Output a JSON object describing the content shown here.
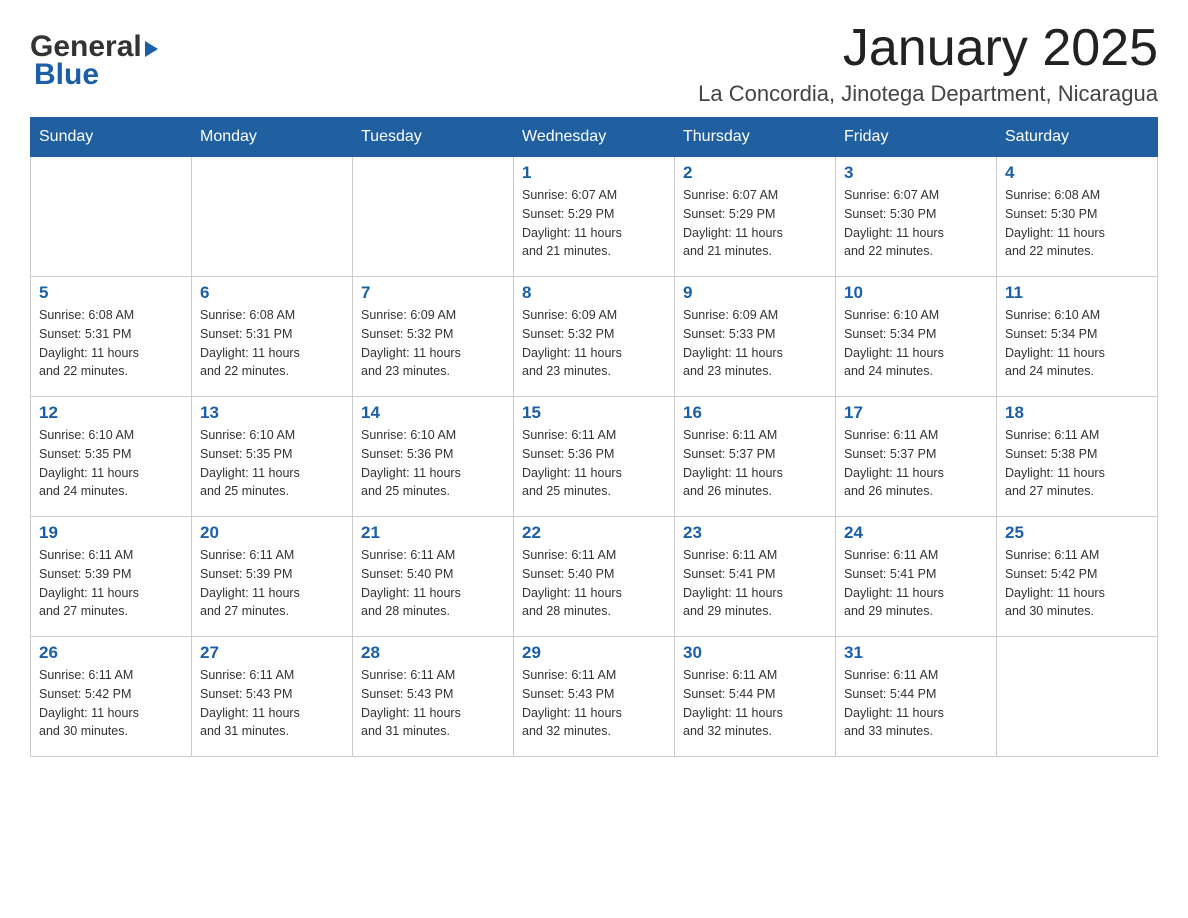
{
  "header": {
    "logo_general": "General",
    "logo_blue": "Blue",
    "month_title": "January 2025",
    "location": "La Concordia, Jinotega Department, Nicaragua"
  },
  "days_of_week": [
    "Sunday",
    "Monday",
    "Tuesday",
    "Wednesday",
    "Thursday",
    "Friday",
    "Saturday"
  ],
  "weeks": [
    [
      {
        "day": "",
        "info": ""
      },
      {
        "day": "",
        "info": ""
      },
      {
        "day": "",
        "info": ""
      },
      {
        "day": "1",
        "info": "Sunrise: 6:07 AM\nSunset: 5:29 PM\nDaylight: 11 hours\nand 21 minutes."
      },
      {
        "day": "2",
        "info": "Sunrise: 6:07 AM\nSunset: 5:29 PM\nDaylight: 11 hours\nand 21 minutes."
      },
      {
        "day": "3",
        "info": "Sunrise: 6:07 AM\nSunset: 5:30 PM\nDaylight: 11 hours\nand 22 minutes."
      },
      {
        "day": "4",
        "info": "Sunrise: 6:08 AM\nSunset: 5:30 PM\nDaylight: 11 hours\nand 22 minutes."
      }
    ],
    [
      {
        "day": "5",
        "info": "Sunrise: 6:08 AM\nSunset: 5:31 PM\nDaylight: 11 hours\nand 22 minutes."
      },
      {
        "day": "6",
        "info": "Sunrise: 6:08 AM\nSunset: 5:31 PM\nDaylight: 11 hours\nand 22 minutes."
      },
      {
        "day": "7",
        "info": "Sunrise: 6:09 AM\nSunset: 5:32 PM\nDaylight: 11 hours\nand 23 minutes."
      },
      {
        "day": "8",
        "info": "Sunrise: 6:09 AM\nSunset: 5:32 PM\nDaylight: 11 hours\nand 23 minutes."
      },
      {
        "day": "9",
        "info": "Sunrise: 6:09 AM\nSunset: 5:33 PM\nDaylight: 11 hours\nand 23 minutes."
      },
      {
        "day": "10",
        "info": "Sunrise: 6:10 AM\nSunset: 5:34 PM\nDaylight: 11 hours\nand 24 minutes."
      },
      {
        "day": "11",
        "info": "Sunrise: 6:10 AM\nSunset: 5:34 PM\nDaylight: 11 hours\nand 24 minutes."
      }
    ],
    [
      {
        "day": "12",
        "info": "Sunrise: 6:10 AM\nSunset: 5:35 PM\nDaylight: 11 hours\nand 24 minutes."
      },
      {
        "day": "13",
        "info": "Sunrise: 6:10 AM\nSunset: 5:35 PM\nDaylight: 11 hours\nand 25 minutes."
      },
      {
        "day": "14",
        "info": "Sunrise: 6:10 AM\nSunset: 5:36 PM\nDaylight: 11 hours\nand 25 minutes."
      },
      {
        "day": "15",
        "info": "Sunrise: 6:11 AM\nSunset: 5:36 PM\nDaylight: 11 hours\nand 25 minutes."
      },
      {
        "day": "16",
        "info": "Sunrise: 6:11 AM\nSunset: 5:37 PM\nDaylight: 11 hours\nand 26 minutes."
      },
      {
        "day": "17",
        "info": "Sunrise: 6:11 AM\nSunset: 5:37 PM\nDaylight: 11 hours\nand 26 minutes."
      },
      {
        "day": "18",
        "info": "Sunrise: 6:11 AM\nSunset: 5:38 PM\nDaylight: 11 hours\nand 27 minutes."
      }
    ],
    [
      {
        "day": "19",
        "info": "Sunrise: 6:11 AM\nSunset: 5:39 PM\nDaylight: 11 hours\nand 27 minutes."
      },
      {
        "day": "20",
        "info": "Sunrise: 6:11 AM\nSunset: 5:39 PM\nDaylight: 11 hours\nand 27 minutes."
      },
      {
        "day": "21",
        "info": "Sunrise: 6:11 AM\nSunset: 5:40 PM\nDaylight: 11 hours\nand 28 minutes."
      },
      {
        "day": "22",
        "info": "Sunrise: 6:11 AM\nSunset: 5:40 PM\nDaylight: 11 hours\nand 28 minutes."
      },
      {
        "day": "23",
        "info": "Sunrise: 6:11 AM\nSunset: 5:41 PM\nDaylight: 11 hours\nand 29 minutes."
      },
      {
        "day": "24",
        "info": "Sunrise: 6:11 AM\nSunset: 5:41 PM\nDaylight: 11 hours\nand 29 minutes."
      },
      {
        "day": "25",
        "info": "Sunrise: 6:11 AM\nSunset: 5:42 PM\nDaylight: 11 hours\nand 30 minutes."
      }
    ],
    [
      {
        "day": "26",
        "info": "Sunrise: 6:11 AM\nSunset: 5:42 PM\nDaylight: 11 hours\nand 30 minutes."
      },
      {
        "day": "27",
        "info": "Sunrise: 6:11 AM\nSunset: 5:43 PM\nDaylight: 11 hours\nand 31 minutes."
      },
      {
        "day": "28",
        "info": "Sunrise: 6:11 AM\nSunset: 5:43 PM\nDaylight: 11 hours\nand 31 minutes."
      },
      {
        "day": "29",
        "info": "Sunrise: 6:11 AM\nSunset: 5:43 PM\nDaylight: 11 hours\nand 32 minutes."
      },
      {
        "day": "30",
        "info": "Sunrise: 6:11 AM\nSunset: 5:44 PM\nDaylight: 11 hours\nand 32 minutes."
      },
      {
        "day": "31",
        "info": "Sunrise: 6:11 AM\nSunset: 5:44 PM\nDaylight: 11 hours\nand 33 minutes."
      },
      {
        "day": "",
        "info": ""
      }
    ]
  ]
}
